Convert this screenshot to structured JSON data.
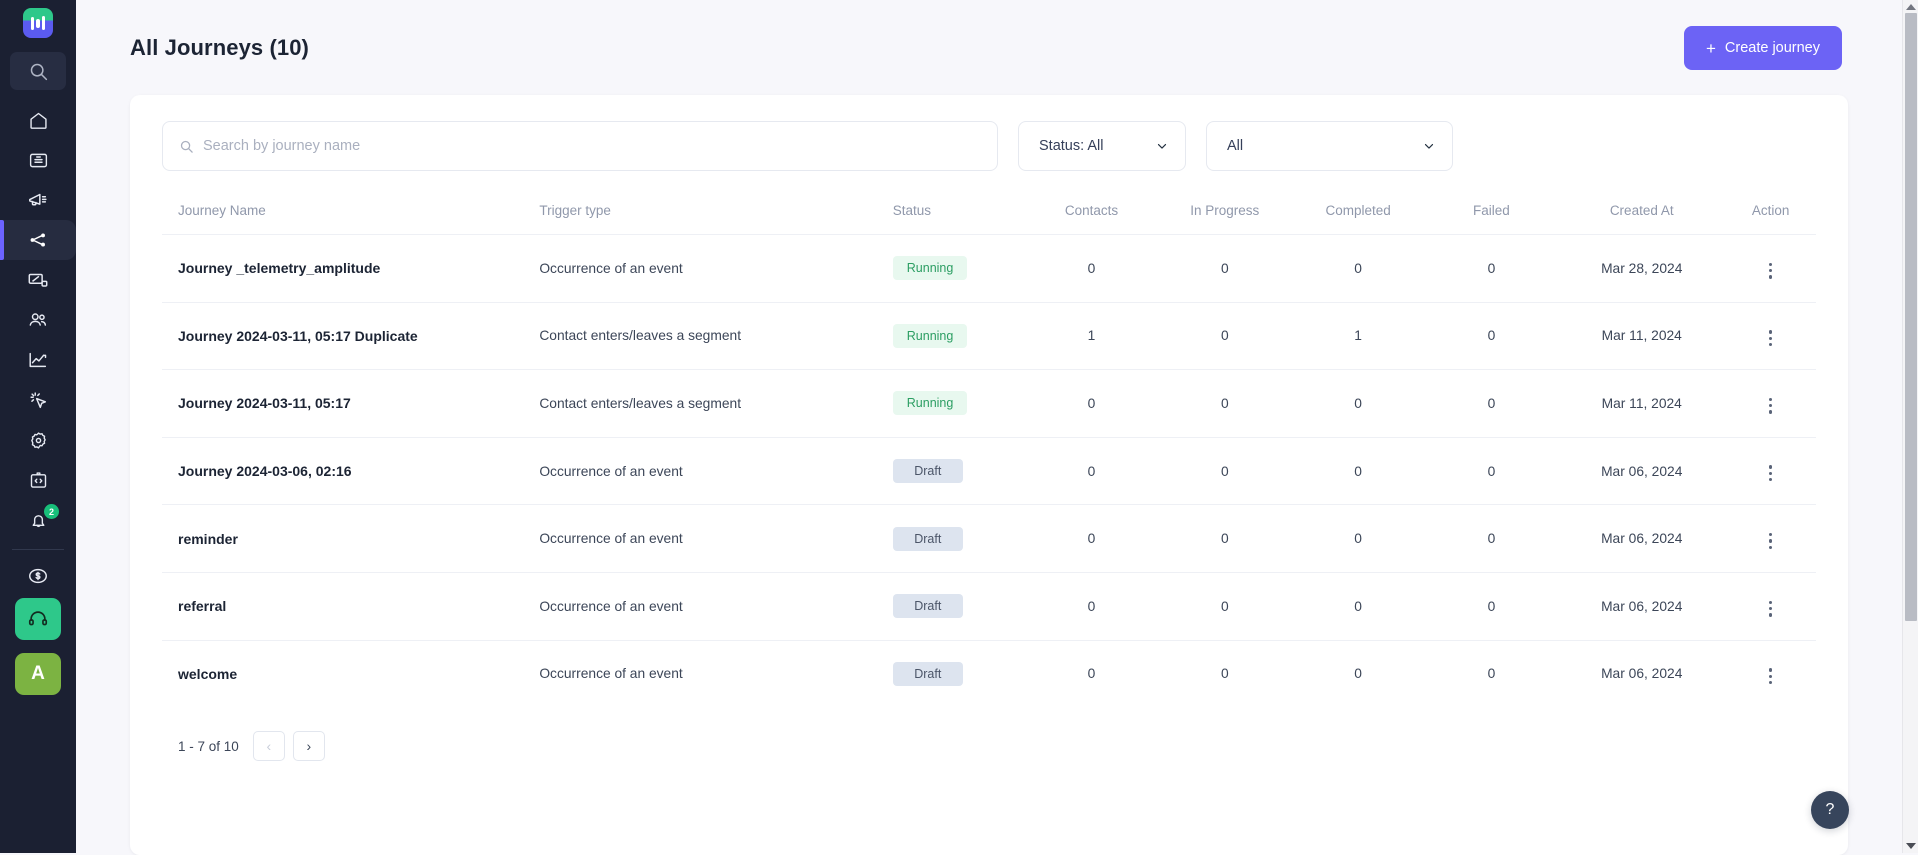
{
  "sidebar": {
    "logo_name": "analytics-logo",
    "search_placeholder_icon": "search-icon",
    "items": [
      {
        "icon": "home-icon",
        "name": "home"
      },
      {
        "icon": "campaigns-icon",
        "name": "campaigns"
      },
      {
        "icon": "broadcast-icon",
        "name": "broadcast"
      },
      {
        "icon": "journeys-icon",
        "name": "journeys",
        "active": true
      },
      {
        "icon": "templates-icon",
        "name": "templates"
      },
      {
        "icon": "audience-icon",
        "name": "audience"
      },
      {
        "icon": "analytics-icon",
        "name": "analytics"
      },
      {
        "icon": "events-icon",
        "name": "events"
      },
      {
        "icon": "settings-icon",
        "name": "settings"
      },
      {
        "icon": "developers-icon",
        "name": "developers"
      },
      {
        "icon": "notifications-icon",
        "name": "notifications",
        "badge": "2"
      }
    ],
    "billing_icon": "dollar-circle-icon",
    "support_icon": "headset-icon",
    "avatar_initial": "A"
  },
  "header": {
    "title": "All Journeys (10)",
    "create_button": "Create journey",
    "create_button_icon": "plus-icon",
    "accent_color": "#6c63f5"
  },
  "filters": {
    "search_placeholder": "Search by journey name",
    "search_value": "",
    "status_filter": "Status: All",
    "type_filter": "All"
  },
  "table": {
    "columns": [
      "Journey Name",
      "Trigger type",
      "Status",
      "Contacts",
      "In Progress",
      "Completed",
      "Failed",
      "Created At",
      "Action"
    ],
    "rows": [
      {
        "name": "Journey _telemetry_amplitude",
        "trigger": "Occurrence of an event",
        "status": "Running",
        "status_kind": "running",
        "contacts": "0",
        "in_progress": "0",
        "completed": "0",
        "failed": "0",
        "created": "Mar 28, 2024"
      },
      {
        "name": "Journey 2024-03-11, 05:17 Duplicate",
        "trigger": "Contact enters/leaves a segment",
        "status": "Running",
        "status_kind": "running",
        "contacts": "1",
        "in_progress": "0",
        "completed": "1",
        "failed": "0",
        "created": "Mar 11, 2024"
      },
      {
        "name": "Journey 2024-03-11, 05:17",
        "trigger": "Contact enters/leaves a segment",
        "status": "Running",
        "status_kind": "running",
        "contacts": "0",
        "in_progress": "0",
        "completed": "0",
        "failed": "0",
        "created": "Mar 11, 2024"
      },
      {
        "name": "Journey 2024-03-06, 02:16",
        "trigger": "Occurrence of an event",
        "status": "Draft",
        "status_kind": "draft",
        "contacts": "0",
        "in_progress": "0",
        "completed": "0",
        "failed": "0",
        "created": "Mar 06, 2024"
      },
      {
        "name": "reminder",
        "trigger": "Occurrence of an event",
        "status": "Draft",
        "status_kind": "draft",
        "contacts": "0",
        "in_progress": "0",
        "completed": "0",
        "failed": "0",
        "created": "Mar 06, 2024"
      },
      {
        "name": "referral",
        "trigger": "Occurrence of an event",
        "status": "Draft",
        "status_kind": "draft",
        "contacts": "0",
        "in_progress": "0",
        "completed": "0",
        "failed": "0",
        "created": "Mar 06, 2024"
      },
      {
        "name": "welcome",
        "trigger": "Occurrence of an event",
        "status": "Draft",
        "status_kind": "draft",
        "contacts": "0",
        "in_progress": "0",
        "completed": "0",
        "failed": "0",
        "created": "Mar 06, 2024"
      }
    ]
  },
  "pagination": {
    "label": "1 - 7 of 10",
    "prev": "‹",
    "next": "›"
  },
  "help": {
    "label": "?"
  },
  "status_colors": {
    "running_bg": "#e8f8ef",
    "running_fg": "#2c9e63",
    "draft_bg": "#dde4ef",
    "draft_fg": "#4b5568"
  }
}
